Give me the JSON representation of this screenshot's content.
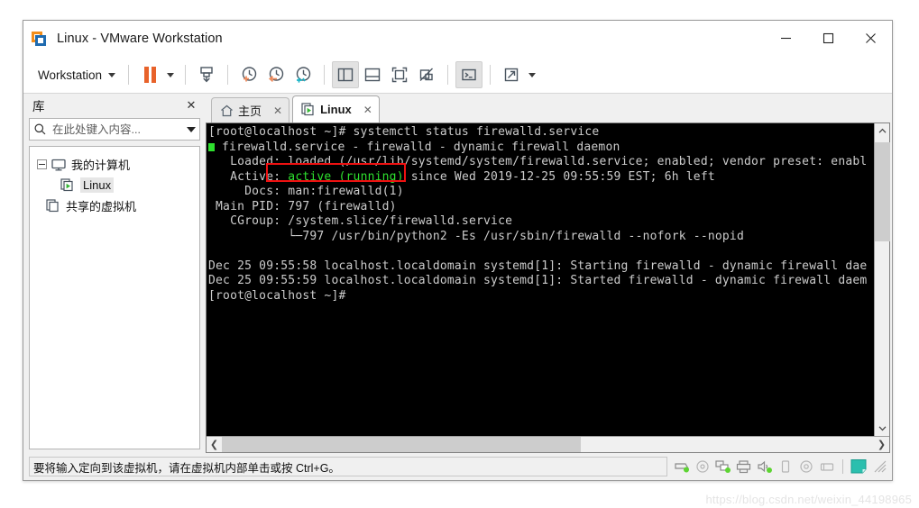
{
  "window": {
    "title": "Linux - VMware Workstation",
    "logo_icon": "vmware-logo-icon",
    "minimize_label": "—",
    "maximize_label": "□",
    "close_label": "✕"
  },
  "toolbar": {
    "menu_label": "Workstation",
    "buttons": [
      {
        "name": "suspend-button",
        "icon": "pause-icon"
      },
      {
        "name": "power-dropdown",
        "icon": "caret-down-icon"
      },
      {
        "name": "snapshot-button",
        "icon": "snapshot-icon"
      },
      {
        "name": "take-snapshot-button",
        "icon": "clock-plus-icon"
      },
      {
        "name": "revert-snapshot-button",
        "icon": "clock-back-icon"
      },
      {
        "name": "manage-snapshots-button",
        "icon": "clock-wrench-icon"
      },
      {
        "name": "show-library-button",
        "icon": "sidebar-panel-icon"
      },
      {
        "name": "show-thumbnails-button",
        "icon": "bottom-panel-icon"
      },
      {
        "name": "full-screen-button",
        "icon": "fullscreen-icon"
      },
      {
        "name": "unity-mode-button",
        "icon": "unity-mode-icon"
      },
      {
        "name": "console-button",
        "icon": "console-prompt-icon"
      },
      {
        "name": "stretch-button",
        "icon": "expand-arrow-icon"
      },
      {
        "name": "stretch-dropdown",
        "icon": "caret-down-icon"
      }
    ]
  },
  "sidebar": {
    "header_title": "库",
    "close_icon_label": "✕",
    "search_placeholder": "在此处键入内容...",
    "search_value": "",
    "tree": [
      {
        "label": "我的计算机",
        "level": 0,
        "icon": "monitor-icon",
        "expanded": true,
        "selected": false
      },
      {
        "label": "Linux",
        "level": 1,
        "icon": "vm-play-icon",
        "selected": true
      },
      {
        "label": "共享的虚拟机",
        "level": 1,
        "icon": "shared-vm-icon",
        "selected": false
      }
    ]
  },
  "tabs": [
    {
      "label": "主页",
      "icon": "home-icon",
      "active": false,
      "close_label": "✕"
    },
    {
      "label": "Linux",
      "icon": "vm-play-icon",
      "active": true,
      "close_label": "✕"
    }
  ],
  "terminal": {
    "prompt_top": "[root@localhost ~]# systemctl status firewalld.service",
    "lines": [
      {
        "type": "bullet",
        "text": " firewalld.service - firewalld - dynamic firewall daemon"
      },
      {
        "type": "plain",
        "text": "   Loaded: loaded (/usr/lib/systemd/system/firewalld.service; enabled; vendor preset: enabl"
      },
      {
        "type": "active",
        "prefix": "   Active: ",
        "green": "active (running)",
        "suffix": " since Wed 2019-12-25 09:55:59 EST; 6h left"
      },
      {
        "type": "plain",
        "text": "     Docs: man:firewalld(1)"
      },
      {
        "type": "plain",
        "text": " Main PID: 797 (firewalld)"
      },
      {
        "type": "plain",
        "text": "   CGroup: /system.slice/firewalld.service"
      },
      {
        "type": "plain",
        "text": "           └─797 /usr/bin/python2 -Es /usr/sbin/firewalld --nofork --nopid"
      },
      {
        "type": "plain",
        "text": ""
      },
      {
        "type": "plain",
        "text": "Dec 25 09:55:58 localhost.localdomain systemd[1]: Starting firewalld - dynamic firewall dae"
      },
      {
        "type": "plain",
        "text": "Dec 25 09:55:59 localhost.localdomain systemd[1]: Started firewalld - dynamic firewall daem"
      },
      {
        "type": "plain",
        "text": "[root@localhost ~]#"
      }
    ],
    "highlight_color": "#ee1111",
    "green_color": "#2ee02e",
    "fg_color": "#cccccc",
    "bg_color": "#000000"
  },
  "scrollbars": {
    "vertical": {
      "up_label": "⌃",
      "down_label": "⌄"
    },
    "horizontal": {
      "left_label": "❮",
      "right_label": "❯"
    }
  },
  "statusbar": {
    "message": "要将输入定向到该虚拟机，请在虚拟机内部单击或按 Ctrl+G。",
    "icons": [
      {
        "name": "hard-disk-icon"
      },
      {
        "name": "cd-dvd-icon"
      },
      {
        "name": "network-adapter-icon"
      },
      {
        "name": "printer-icon"
      },
      {
        "name": "sound-card-icon"
      },
      {
        "name": "mobile-device-icon"
      },
      {
        "name": "optical-drive-icon"
      },
      {
        "name": "usb-device-icon"
      },
      {
        "name": "message-note-icon"
      }
    ]
  },
  "watermark": "https://blog.csdn.net/weixin_44198965"
}
